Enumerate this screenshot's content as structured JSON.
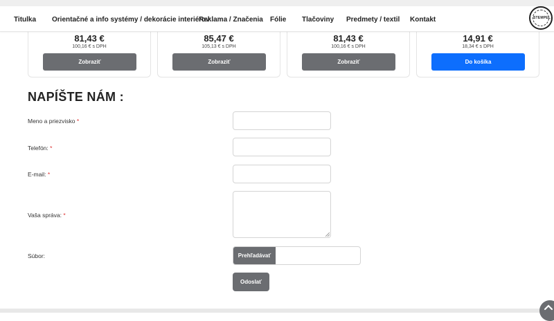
{
  "nav": {
    "items": [
      "Titulka",
      "Orientačné a info systémy / dekorácie interiérov",
      "Reklama / Značenia",
      "Fólie",
      "Tlačoviny",
      "Predmety / textil",
      "Kontakt"
    ],
    "logo_text": "STEMPEL"
  },
  "products": [
    {
      "price": "81,43 €",
      "price_vat": "100,16 € s DPH",
      "button": "Zobraziť"
    },
    {
      "price": "85,47 €",
      "price_vat": "105,13 € s DPH",
      "button": "Zobraziť"
    },
    {
      "price": "81,43 €",
      "price_vat": "100,16 € s DPH",
      "button": "Zobraziť"
    },
    {
      "price": "14,91 €",
      "price_vat": "18,34 € s DPH",
      "button": "Do košíka"
    }
  ],
  "form": {
    "title": "NAPÍŠTE NÁM :",
    "name_label": "Meno a priezvisko",
    "phone_label": "Telefón:",
    "email_label": "E-mail:",
    "message_label": "Vaša správa:",
    "file_label": "Súbor:",
    "required_mark": "*",
    "browse_button": "Prehľadávať",
    "submit_button": "Odoslať"
  },
  "colors": {
    "button_gray": "#6b6d71",
    "button_blue": "#0d6efd",
    "required": "#dd3333"
  }
}
